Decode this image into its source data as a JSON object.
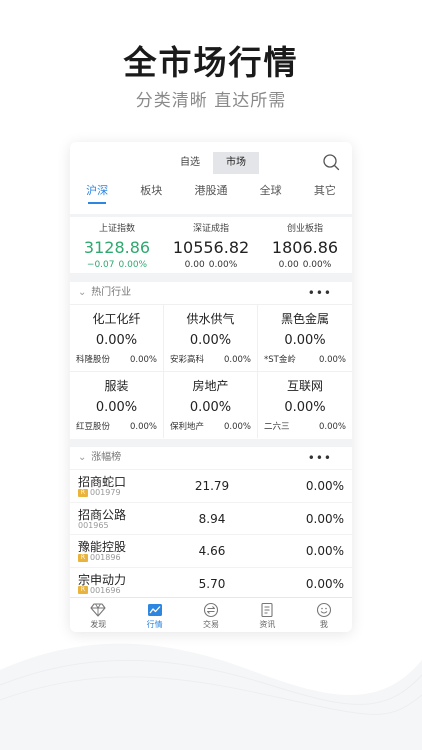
{
  "hero": {
    "title": "全市场行情",
    "subtitle": "分类清晰 直达所需"
  },
  "topbar": {
    "segments": [
      "自选",
      "市场"
    ],
    "active_segment": "市场",
    "tabs": [
      "沪深",
      "板块",
      "港股通",
      "全球",
      "其它"
    ],
    "active_tab": "沪深"
  },
  "indices": [
    {
      "name": "上证指数",
      "value": "3128.86",
      "change": "−0.07",
      "pct": "0.00%"
    },
    {
      "name": "深证成指",
      "value": "10556.82",
      "change": "0.00",
      "pct": "0.00%"
    },
    {
      "name": "创业板指",
      "value": "1806.86",
      "change": "0.00",
      "pct": "0.00%"
    }
  ],
  "sectors": {
    "title": "热门行业",
    "more": "•••",
    "items": [
      {
        "name": "化工化纤",
        "pct": "0.00%",
        "stock": "科隆股份",
        "stock_pct": "0.00%"
      },
      {
        "name": "供水供气",
        "pct": "0.00%",
        "stock": "安彩高科",
        "stock_pct": "0.00%"
      },
      {
        "name": "黑色金属",
        "pct": "0.00%",
        "stock": "*ST金岭",
        "stock_pct": "0.00%"
      },
      {
        "name": "服装",
        "pct": "0.00%",
        "stock": "红豆股份",
        "stock_pct": "0.00%"
      },
      {
        "name": "房地产",
        "pct": "0.00%",
        "stock": "保利地产",
        "stock_pct": "0.00%"
      },
      {
        "name": "互联网",
        "pct": "0.00%",
        "stock": "二六三",
        "stock_pct": "0.00%"
      }
    ]
  },
  "movers": {
    "title": "涨幅榜",
    "more": "•••",
    "badge": "R",
    "rows": [
      {
        "name": "招商蛇口",
        "code": "001979",
        "price": "21.79",
        "pct": "0.00%"
      },
      {
        "name": "招商公路",
        "code": "001965",
        "price": "8.94",
        "pct": "0.00%"
      },
      {
        "name": "豫能控股",
        "code": "001896",
        "price": "4.66",
        "pct": "0.00%"
      },
      {
        "name": "宗申动力",
        "code": "001696",
        "price": "5.70",
        "pct": "0.00%"
      }
    ]
  },
  "nav": [
    {
      "label": "发现",
      "icon": "diamond-icon"
    },
    {
      "label": "行情",
      "icon": "chart-icon"
    },
    {
      "label": "交易",
      "icon": "exchange-icon"
    },
    {
      "label": "资讯",
      "icon": "document-icon"
    },
    {
      "label": "我",
      "icon": "smiley-icon"
    }
  ],
  "colors": {
    "accent": "#2d86e0",
    "down_green": "#2fa86f",
    "badge": "#e9b33c"
  }
}
